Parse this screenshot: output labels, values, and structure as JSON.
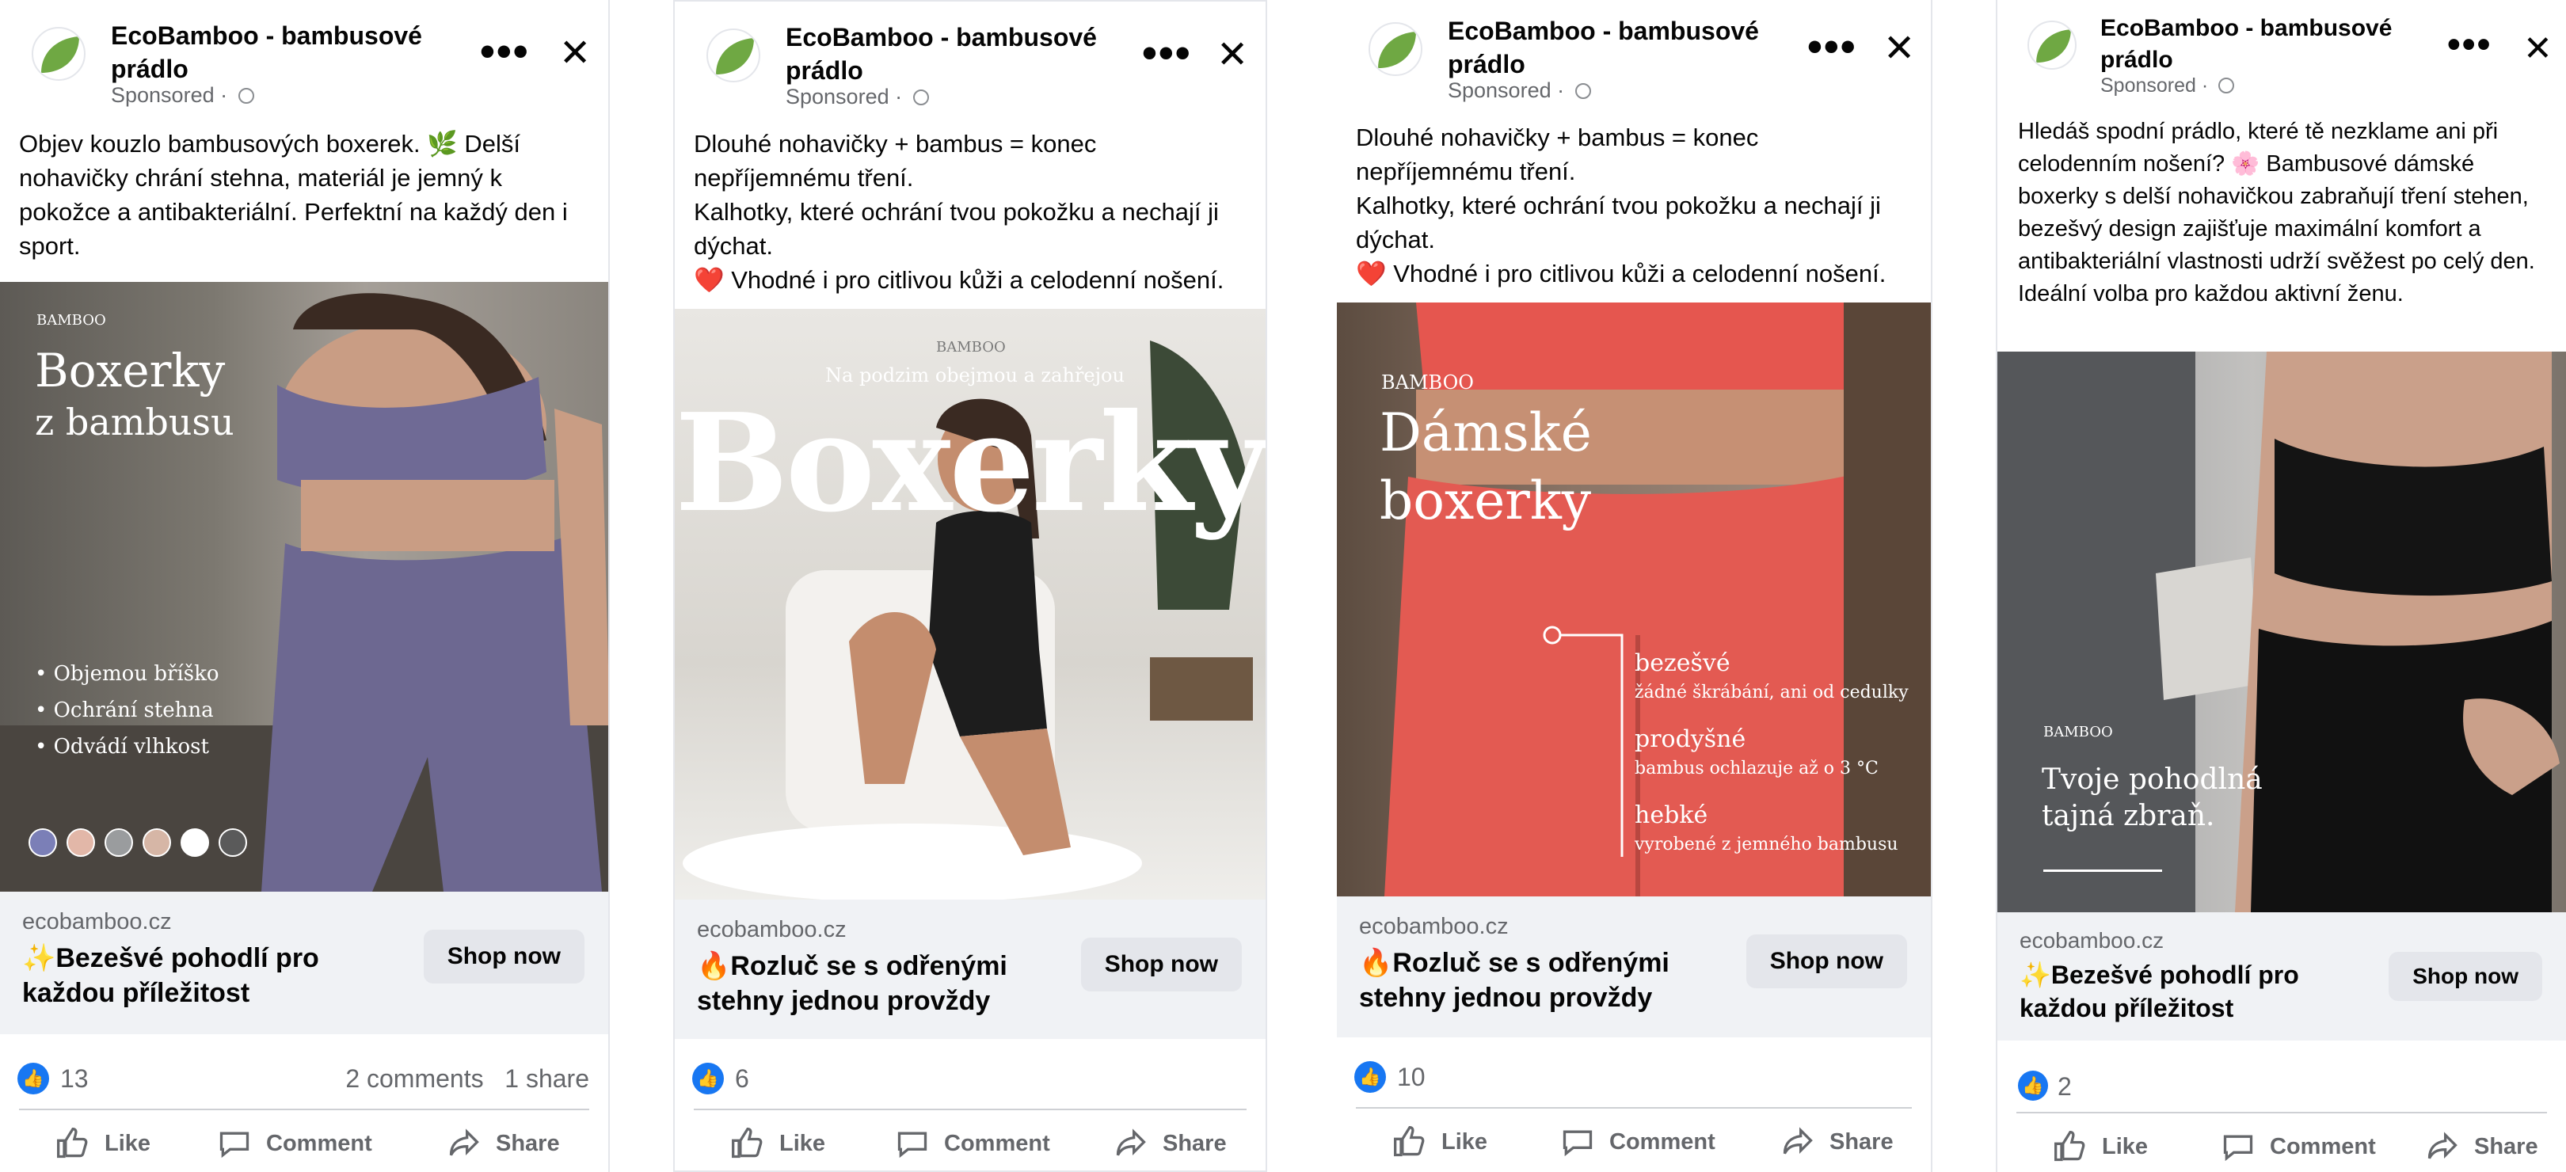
{
  "common": {
    "page_name": "EcoBamboo - bambusové prádlo",
    "sponsored": "Sponsored",
    "more_glyph": "•••",
    "close_glyph": "✕",
    "actions": {
      "like": "Like",
      "comment": "Comment",
      "share": "Share"
    },
    "shop_label": "Shop now",
    "domain": "ecobamboo.cz",
    "brand_eco": "eco",
    "brand_bamboo": "BAMBOO",
    "colors": {
      "accent": "#1877f2",
      "leaf": "#6fa843",
      "muted": "#65676b"
    }
  },
  "posts": [
    {
      "body": "Objev kouzlo bambusových boxerek. 🌿 Delší nohavičky chrání stehna, materiál je jemný k pokožce a antibakteriální. Perfektní na každý den i sport.",
      "image": {
        "title1": "Boxerky",
        "title2": "z bambusu",
        "bullets": [
          "Objemou bříško",
          "Ochrání stehna",
          "Odvádí vlhkost"
        ],
        "swatches": [
          "#7b7fb7",
          "#e2b7a8",
          "#9a9c9e",
          "#d6b6a6",
          "#ffffff",
          "#5a5a5a"
        ]
      },
      "headline": "✨Bezešvé pohodlí pro každou příležitost",
      "likes": "13",
      "comments": "2 comments",
      "shares": "1 share"
    },
    {
      "body": "Dlouhé nohavičky + bambus = konec nepříjemnému tření.\nKalhotky, které ochrání tvou pokožku a nechají ji dýchat.\n❤️ Vhodné i pro citlivou kůži a celodenní nošení.",
      "image": {
        "tagline": "Na podzim obejmou a zahřejou",
        "big": "Boxerky"
      },
      "headline": "🔥Rozluč se s odřenými stehny jednou provždy",
      "likes": "6"
    },
    {
      "body": "Dlouhé nohavičky + bambus = konec nepříjemnému tření.\nKalhotky, které ochrání tvou pokožku a nechají ji dýchat.\n❤️ Vhodné i pro citlivou kůži a celodenní nošení.",
      "image": {
        "title1": "Dámské",
        "title2": "boxerky",
        "features": [
          {
            "title": "bezešvé",
            "sub": "žádné škrábání, ani od cedulky"
          },
          {
            "title": "prodyšné",
            "sub": "bambus ochlazuje až o 3 °C"
          },
          {
            "title": "hebké",
            "sub": "vyrobené z jemného bambusu"
          }
        ]
      },
      "headline": "🔥Rozluč se s odřenými stehny jednou provždy",
      "likes": "10"
    },
    {
      "body": "Hledáš spodní prádlo, které tě nezklame ani při celodenním nošení? 🌸 Bambusové dámské boxerky s delší nohavičkou zabraňují tření stehen, bezešvý design zajišťuje maximální komfort a antibakteriální vlastnosti udrží svěžest po celý den. Ideální volba pro každou aktivní ženu.",
      "image": {
        "title1": "Tvoje pohodlná",
        "title2": "tajná zbraň."
      },
      "headline": "✨Bezešvé pohodlí pro každou příležitost",
      "likes": "2"
    }
  ]
}
